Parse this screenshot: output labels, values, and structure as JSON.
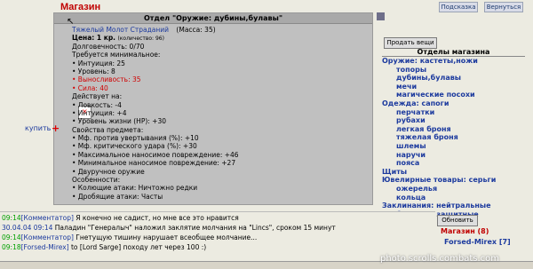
{
  "header": {
    "title": "Магазин",
    "hint_label": "Подсказка",
    "back_label": "Вернуться"
  },
  "item_panel": {
    "header": "Отдел \"Оружие: дубины,булавы\"",
    "name": "Тяжелый Молот Страданий",
    "mass": "(Масса: 35)",
    "price": "Цена: 1 кр.",
    "quantity": "(количество: 96)",
    "durability": "Долговечность: 0/70",
    "required_title": "Требуется минимальное:",
    "requirements": [
      {
        "text": "• Интуиция: 25",
        "red": false
      },
      {
        "text": "• Уровень: 8",
        "red": false
      },
      {
        "text": "• Выносливость: 35",
        "red": true
      },
      {
        "text": "• Сила: 40",
        "red": true
      }
    ],
    "effects_title": "Действует на:",
    "effects": [
      "• Ловкость: -4",
      "• Интуиция: +4",
      "• Уровень жизни (HP): +30"
    ],
    "properties_title": "Свойства предмета:",
    "properties": [
      "• Мф. против увертывания (%): +10",
      "• Мф. критического удара (%): +30",
      "• Максимальное наносимое повреждение: +46",
      "• Минимальное наносимое повреждение: +27",
      "• Двуручное оружие"
    ],
    "features_title": "Особенности:",
    "features": [
      "• Колющие атаки: Ничтожно редки",
      "• Дробящие атаки: Часты"
    ],
    "buy_label": "купить",
    "buy_plus": "+"
  },
  "sidebar": {
    "sell_label": "Продать вещи",
    "categories_title": "Отделы магазина",
    "categories": [
      {
        "label": "Оружие: кастеты,ножи",
        "sub": false
      },
      {
        "label": "топоры",
        "sub": true
      },
      {
        "label": "дубины,булавы",
        "sub": true
      },
      {
        "label": "мечи",
        "sub": true
      },
      {
        "label": "магические посохи",
        "sub": true
      },
      {
        "label": "Одежда: сапоги",
        "sub": false
      },
      {
        "label": "перчатки",
        "sub": true
      },
      {
        "label": "рубахи",
        "sub": true
      },
      {
        "label": "легкая броня",
        "sub": true
      },
      {
        "label": "тяжелая броня",
        "sub": true
      },
      {
        "label": "шлемы",
        "sub": true
      },
      {
        "label": "наручи",
        "sub": true
      },
      {
        "label": "пояса",
        "sub": true
      },
      {
        "label": "Щиты",
        "sub": false
      },
      {
        "label": "Ювелирные товары: серьги",
        "sub": false
      },
      {
        "label": "ожерелья",
        "sub": true
      },
      {
        "label": "кольца",
        "sub": true
      },
      {
        "label": "Заклинания: нейтральные",
        "sub": false
      },
      {
        "label": "боевые и защитные",
        "sub": true
      }
    ]
  },
  "chat": {
    "lines": [
      {
        "time": "09:14",
        "speaker": "[Комментатор]",
        "text": " Я конечно не садист, но мне все это нравится"
      },
      {
        "time": "30.04.04 09:14",
        "speaker": "",
        "text": " Паладин \"Генералыч\" наложил заклятие молчания на \"Lincs\", сроком 15 минут"
      },
      {
        "time": "09:14",
        "speaker": "[Комментатор]",
        "text": " Гнетущую тишину нарушает всеобщее молчание..."
      },
      {
        "time": "09:18",
        "speaker": "[Forsed-Mirex]",
        "text": " to [Lord Sarge] походу лет через 100 :)"
      }
    ],
    "refresh_label": "Обновить",
    "online_title": "Магазин (8)",
    "online_user": "Forsed-Mirex [7]"
  },
  "watermark": "photo.scrolls.combats.com",
  "colors": {
    "title_red": "#c00000",
    "link_blue": "#1c3a9e",
    "panel_gray": "#c0c0c0",
    "time_green": "#00a000"
  }
}
